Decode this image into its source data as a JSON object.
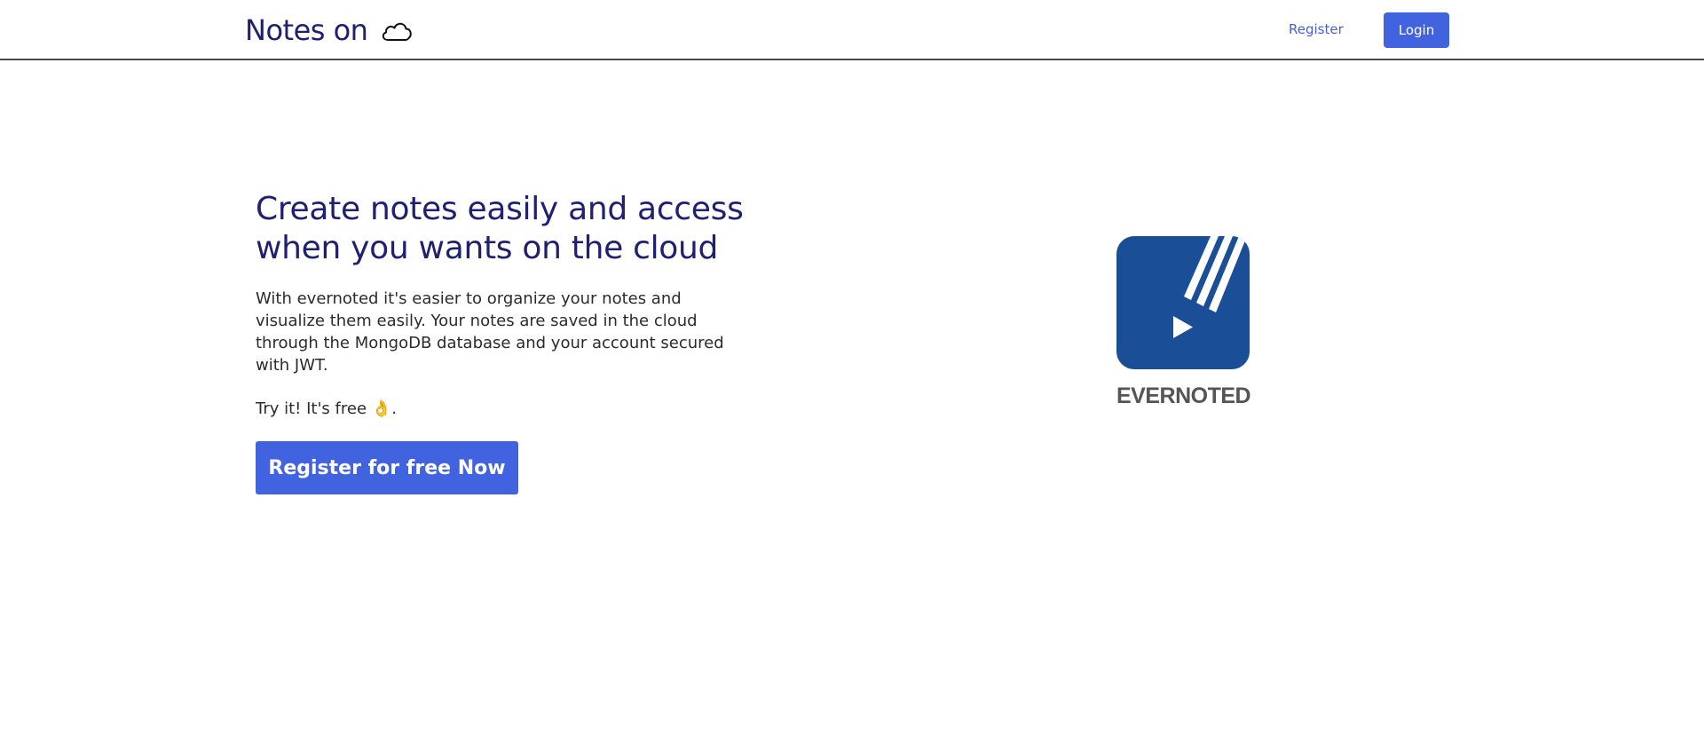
{
  "navbar": {
    "brand_text": "Notes on",
    "brand_icon": "cloud-icon",
    "register_label": "Register",
    "login_label": "Login"
  },
  "hero": {
    "title_line1": "Create notes easily and access",
    "title_line2": "when you wants on the cloud",
    "description": "With evernoted it's easier to organize your notes and visualize them easily. Your notes are saved in the cloud through the MongoDB database and your account secured with JWT.",
    "try_text": "Try it! It's free",
    "try_emoji": "👌",
    "try_period": ".",
    "cta_label": "Register for free Now"
  },
  "logo": {
    "text": "EVERNOTED",
    "icon": "evernoted-logo-icon"
  },
  "colors": {
    "brand": "#1f2072",
    "accent": "#4263e0",
    "logo_blue": "#1a4f97"
  }
}
